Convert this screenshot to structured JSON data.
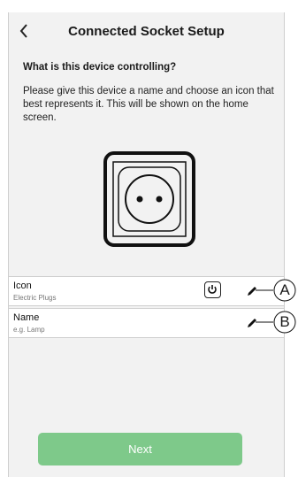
{
  "header": {
    "title": "Connected Socket Setup"
  },
  "section": {
    "question": "What is this device controlling?",
    "description": "Please give this device a name and choose an icon that best represents it. This will be shown on the home screen."
  },
  "rows": {
    "icon": {
      "label": "Icon",
      "value": "Electric Plugs",
      "callout": "A"
    },
    "name": {
      "label": "Name",
      "placeholder": "e.g. Lamp",
      "callout": "B"
    }
  },
  "footer": {
    "next_label": "Next"
  },
  "colors": {
    "accent": "#7ec98a",
    "background": "#f2f2f2"
  },
  "icons": {
    "back": "chevron-left-icon",
    "device": "socket-icon",
    "edit": "pencil-icon",
    "icon_preview": "power-icon"
  }
}
